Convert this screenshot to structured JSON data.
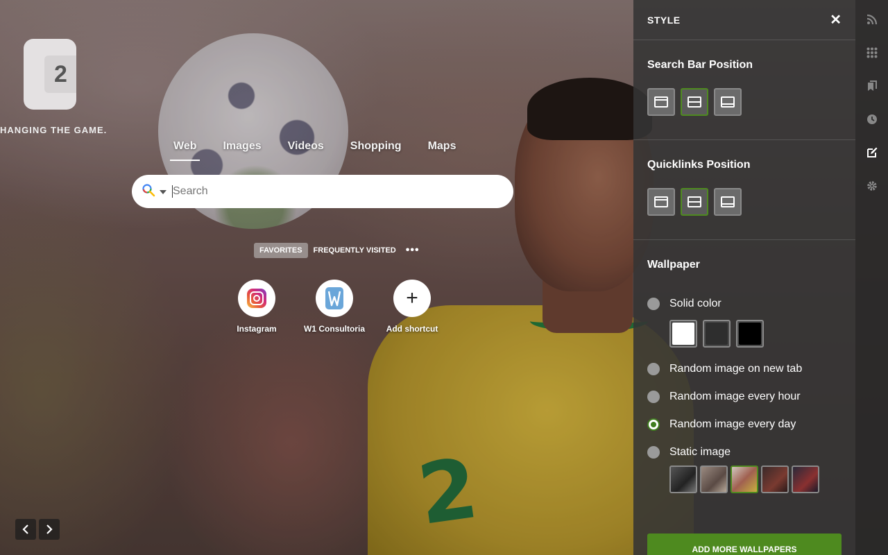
{
  "brand": {
    "logo_glyph": "2",
    "tagline": "HANGING THE GAME."
  },
  "search": {
    "tabs": [
      {
        "label": "Web",
        "active": true
      },
      {
        "label": "Images",
        "active": false
      },
      {
        "label": "Videos",
        "active": false
      },
      {
        "label": "Shopping",
        "active": false
      },
      {
        "label": "Maps",
        "active": false
      }
    ],
    "placeholder": "Search",
    "value": "",
    "engine_icon": "search-icon"
  },
  "quicklinks": {
    "tabs": [
      {
        "label": "FAVORITES",
        "active": true
      },
      {
        "label": "FREQUENTLY VISITED",
        "active": false
      }
    ],
    "more_label": "•••",
    "items": [
      {
        "label": "Instagram",
        "icon": "instagram-icon"
      },
      {
        "label": "W1 Consultoria",
        "icon": "w1-consultoria-icon"
      },
      {
        "label": "Add shortcut",
        "icon": "plus-icon"
      }
    ],
    "add_glyph": "+"
  },
  "wallpaper_nav": {
    "prev_glyph": "‹",
    "next_glyph": "›"
  },
  "style_panel": {
    "title": "STYLE",
    "close_glyph": "✕",
    "search_bar_position": {
      "title": "Search Bar Position",
      "options": [
        "top",
        "middle",
        "bottom"
      ],
      "selected": "middle"
    },
    "quicklinks_position": {
      "title": "Quicklinks Position",
      "options": [
        "top",
        "middle",
        "bottom"
      ],
      "selected": "middle"
    },
    "wallpaper": {
      "title": "Wallpaper",
      "options": [
        {
          "label": "Solid color",
          "checked": false
        },
        {
          "label": "Random image on new tab",
          "checked": false
        },
        {
          "label": "Random image every hour",
          "checked": false
        },
        {
          "label": "Random image every day",
          "checked": true
        },
        {
          "label": "Static image",
          "checked": false
        }
      ],
      "solid_colors": [
        "#ffffff",
        "#2e2e2e",
        "#000000"
      ],
      "selected_thumbnail": 3
    },
    "add_more_label": "ADD MORE WALLPAPERS"
  },
  "colors": {
    "accent": "#4e8a1f",
    "panel_bg": "#343434"
  },
  "rail": {
    "icons": [
      "rss-icon",
      "apps-grid-icon",
      "bookmarks-icon",
      "history-icon",
      "edit-style-icon",
      "settings-gear-icon"
    ],
    "active": "edit-style-icon"
  }
}
